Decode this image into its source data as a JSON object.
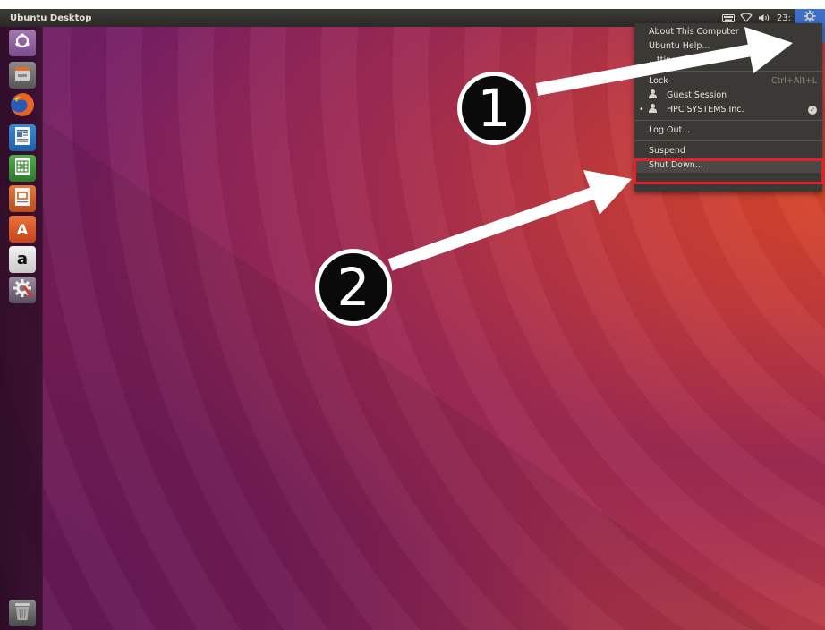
{
  "panel": {
    "title": "Ubuntu Desktop",
    "clock": "23:"
  },
  "launcher": {
    "items": [
      {
        "name": "dash-home",
        "icon": "ubuntu-logo-icon"
      },
      {
        "name": "files",
        "icon": "file-cabinet-icon"
      },
      {
        "name": "firefox",
        "icon": "firefox-icon"
      },
      {
        "name": "libreoffice-writer",
        "icon": "writer-icon"
      },
      {
        "name": "libreoffice-calc",
        "icon": "calc-icon"
      },
      {
        "name": "libreoffice-impress",
        "icon": "impress-icon"
      },
      {
        "name": "ubuntu-software",
        "icon": "software-bag-icon",
        "glyph": "A"
      },
      {
        "name": "amazon",
        "icon": "amazon-icon",
        "glyph": "a"
      },
      {
        "name": "system-settings",
        "icon": "settings-gear-icon"
      },
      {
        "name": "trash",
        "icon": "trash-icon"
      }
    ]
  },
  "menu": {
    "about": "About This Computer",
    "help": "Ubuntu Help...",
    "settings": "...ttings...",
    "lock": "Lock",
    "lock_accel": "Ctrl+Alt+L",
    "guest": "Guest Session",
    "user": "HPC SYSTEMS Inc.",
    "user_bullet": "•",
    "logout": "Log Out...",
    "suspend": "Suspend",
    "shutdown": "Shut Down..."
  },
  "annotations": {
    "badge_1": "1",
    "badge_2": "2",
    "session_highlight_color": "#3f6fc7",
    "shutdown_highlight_color": "#e3202a"
  },
  "colors": {
    "panel_bg": "#2b2a27",
    "menu_bg": "#3a3935",
    "accent_purple": "#8a2160",
    "accent_orange": "#d6442a"
  }
}
